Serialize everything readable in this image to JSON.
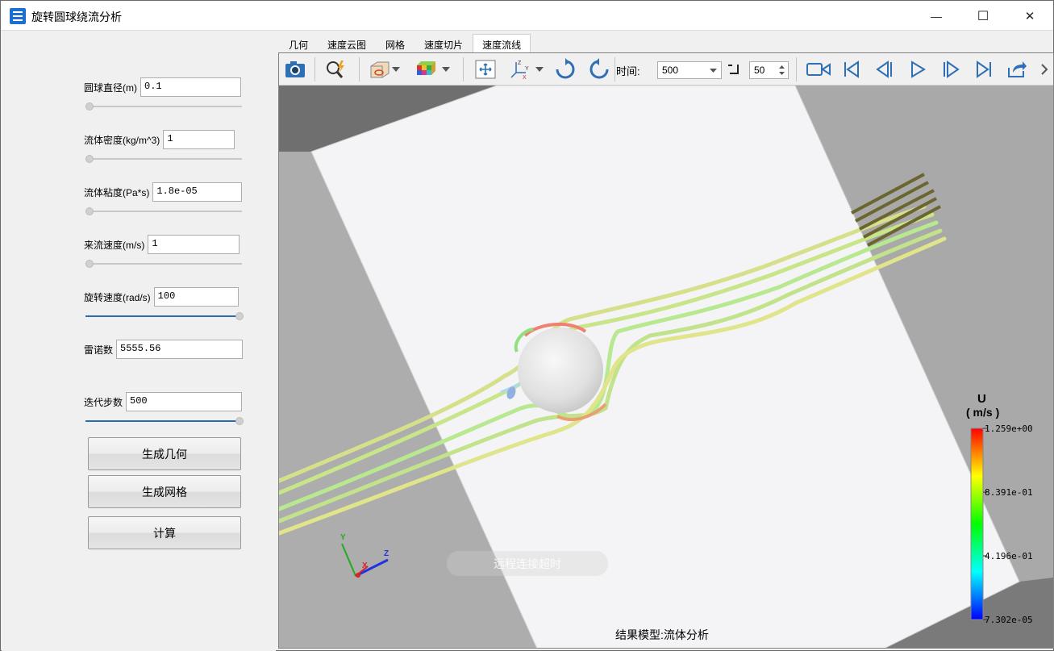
{
  "app": {
    "title": "旋转圆球绕流分析"
  },
  "window_controls": {
    "minimize": "—",
    "maximize": "☐",
    "close": "✕"
  },
  "params": [
    {
      "label": "圆球直径(m)",
      "value": "0.1",
      "slider": 0.0
    },
    {
      "label": "流体密度(kg/m^3)",
      "value": "1",
      "slider": 0.0
    },
    {
      "label": "流体粘度(Pa*s)",
      "value": "1.8e-05",
      "slider": 0.0
    },
    {
      "label": "来流速度(m/s)",
      "value": "1",
      "slider": 0.0
    },
    {
      "label": "旋转速度(rad/s)",
      "value": "100",
      "slider": 1.0
    },
    {
      "label": "雷诺数",
      "value": "5555.56"
    },
    {
      "label": "迭代步数",
      "value": "500",
      "slider": 1.0
    }
  ],
  "buttons": {
    "gen_geometry": "生成几何",
    "gen_mesh": "生成网格",
    "compute": "计算"
  },
  "tabs": [
    "几何",
    "速度云图",
    "网格",
    "速度切片",
    "速度流线"
  ],
  "active_tab": 4,
  "toolbar": {
    "time_label": "时间:",
    "time_value": "500",
    "step_value": "50",
    "icons": [
      "camera-icon",
      "zoom-icon",
      "view-box-icon",
      "color-cube-icon",
      "fit-view-icon",
      "axes-orient-icon",
      "rotate-cw-icon",
      "rotate-ccw-icon",
      "record-icon",
      "first-frame-icon",
      "prev-frame-icon",
      "play-icon",
      "next-frame-icon",
      "last-frame-icon",
      "export-icon"
    ]
  },
  "legend": {
    "title": "U",
    "unit": "( m/s )",
    "ticks": [
      "1.259e+00",
      "8.391e-01",
      "4.196e-01",
      "7.302e-05"
    ]
  },
  "axes": {
    "y": "Y",
    "x": "X",
    "z": "Z"
  },
  "watermark": "远程连接超时",
  "footer_caption": "结果模型:流体分析",
  "colors": {
    "accent": "#2b6cb0",
    "sphere": "#e6e6e6",
    "wall_dark": "#a9a9a9",
    "wall_light": "#bdbdbd",
    "floor": "#f5f5f6"
  }
}
